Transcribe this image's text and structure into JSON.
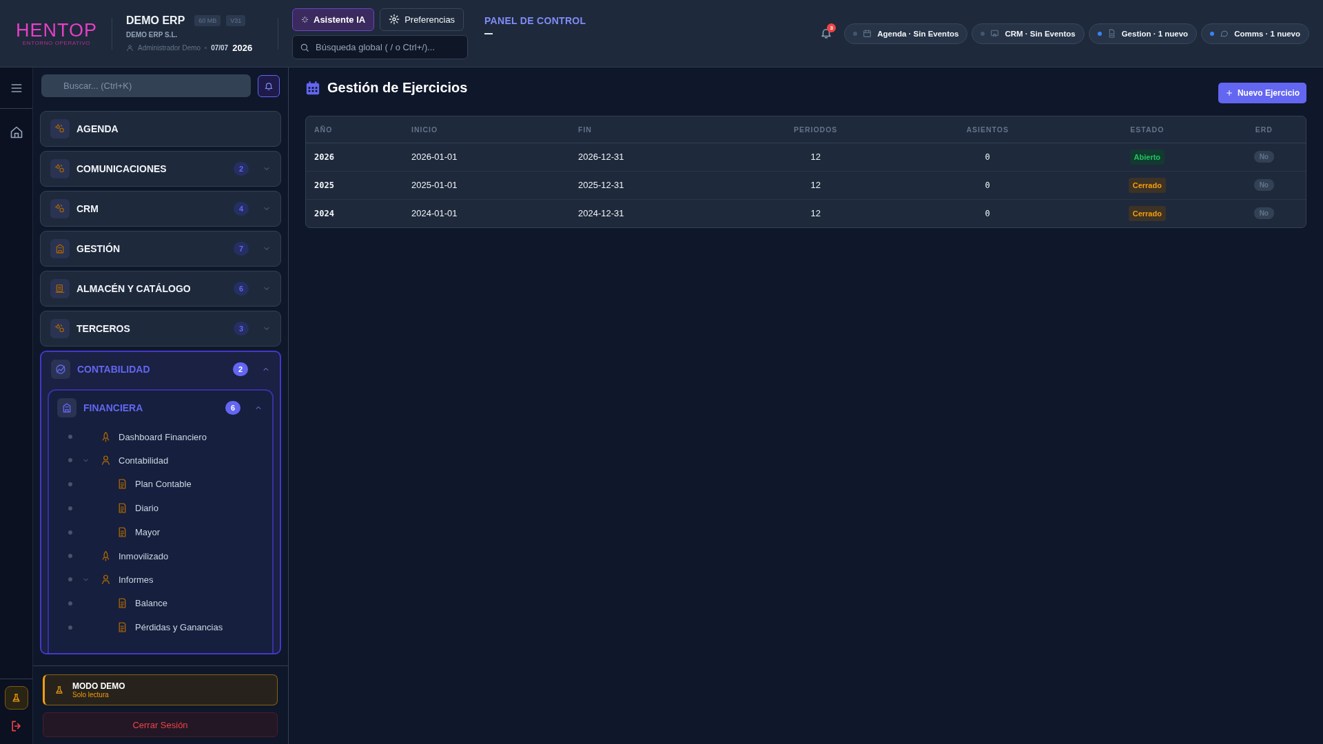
{
  "header": {
    "logo": {
      "name": "HENTOP",
      "tagline": "ENTORNO OPERATIVO"
    },
    "company": {
      "name": "DEMO ERP",
      "size": "60 MB",
      "version": "V31",
      "legal_name": "DEMO ERP S.L.",
      "user": "Administrador Demo",
      "date": "07/07",
      "year": "2026"
    },
    "buttons": [
      {
        "label": "Asistente IA",
        "kind": "ai"
      },
      {
        "label": "Preferencias",
        "kind": "settings"
      }
    ],
    "search": {
      "placeholder": "Búsqueda global ( / o Ctrl+/)..."
    },
    "nav_link": "PANEL DE CONTROL",
    "notifications": "3",
    "status_pills": [
      {
        "label": "Agenda · Sin Eventos",
        "kind": "calendar",
        "color": "#475569"
      },
      {
        "label": "CRM · Sin Eventos",
        "kind": "board",
        "color": "#475569"
      },
      {
        "label": "Gestion · 1 nuevo",
        "kind": "document",
        "color": "#3b82f6"
      },
      {
        "label": "Comms · 1 nuevo",
        "kind": "chat",
        "color": "#3b82f6"
      }
    ]
  },
  "sidebar": {
    "search": {
      "placeholder": "Buscar... (Ctrl+K)"
    },
    "sections": [
      {
        "label": "AGENDA",
        "expanded": false
      },
      {
        "label": "COMUNICACIONES",
        "count": "2",
        "expanded": false
      },
      {
        "label": "CRM",
        "count": "4",
        "expanded": false
      },
      {
        "label": "GESTIÓN",
        "count": "7",
        "expanded": false
      },
      {
        "label": "ALMACÉN Y CATÁLOGO",
        "count": "6",
        "expanded": false
      },
      {
        "label": "TERCEROS",
        "count": "3",
        "expanded": false
      },
      {
        "label": "CONTABILIDAD",
        "count": "2",
        "expanded": true,
        "groups": [
          {
            "label": "FINANCIERA",
            "count": "6",
            "expanded": true,
            "children": [
              {
                "label": "Dashboard Financiero"
              },
              {
                "label": "Contabilidad",
                "expanded": true,
                "children": [
                  {
                    "label": "Plan Contable"
                  },
                  {
                    "label": "Diario"
                  },
                  {
                    "label": "Mayor"
                  }
                ]
              },
              {
                "label": "Inmovilizado"
              },
              {
                "label": "Informes",
                "expanded": true,
                "children": [
                  {
                    "label": "Balance"
                  },
                  {
                    "label": "Pérdidas y Ganancias"
                  }
                ]
              }
            ]
          }
        ]
      }
    ],
    "demo": {
      "title": "MODO DEMO",
      "subtitle": "Solo lectura"
    },
    "logout": "Cerrar Sesión"
  },
  "main": {
    "title": "Gestión de Ejercicios",
    "new_button": "Nuevo Ejercicio",
    "table": {
      "columns": [
        "AÑO",
        "INICIO",
        "FIN",
        "PERIODOS",
        "ASIENTOS",
        "ESTADO",
        "ERD"
      ],
      "rows": [
        {
          "year": "2026",
          "start": "2026-01-01",
          "end": "2026-12-31",
          "periods": "12",
          "entries": "0",
          "status": {
            "label": "Abierto",
            "kind": "open"
          },
          "erd": "No"
        },
        {
          "year": "2025",
          "start": "2025-01-01",
          "end": "2025-12-31",
          "periods": "12",
          "entries": "0",
          "status": {
            "label": "Cerrado",
            "kind": "closed"
          },
          "erd": "No"
        },
        {
          "year": "2024",
          "start": "2024-01-01",
          "end": "2024-12-31",
          "periods": "12",
          "entries": "0",
          "status": {
            "label": "Cerrado",
            "kind": "closed"
          },
          "erd": "No"
        }
      ]
    }
  }
}
